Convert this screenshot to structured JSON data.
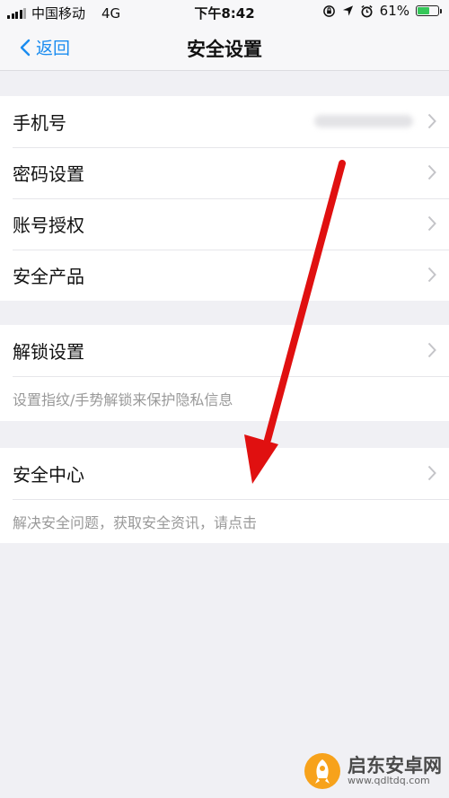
{
  "status_bar": {
    "carrier": "中国移动",
    "network": "4G",
    "time": "下午8:42",
    "battery_percent": "61%",
    "battery_level": 0.61,
    "battery_color": "#35c759"
  },
  "nav": {
    "back_label": "返回",
    "title": "安全设置"
  },
  "section1": {
    "items": [
      {
        "label": "手机号"
      },
      {
        "label": "密码设置"
      },
      {
        "label": "账号授权"
      },
      {
        "label": "安全产品"
      }
    ]
  },
  "section2": {
    "item": "解锁设置",
    "hint": "设置指纹/手势解锁来保护隐私信息"
  },
  "section3": {
    "item": "安全中心",
    "hint": "解决安全问题，获取安全资讯，请点击"
  },
  "annotation": {
    "arrow_color": "#e01010"
  },
  "watermark": {
    "name": "启东安卓网",
    "url": "www.qdltdq.com"
  }
}
